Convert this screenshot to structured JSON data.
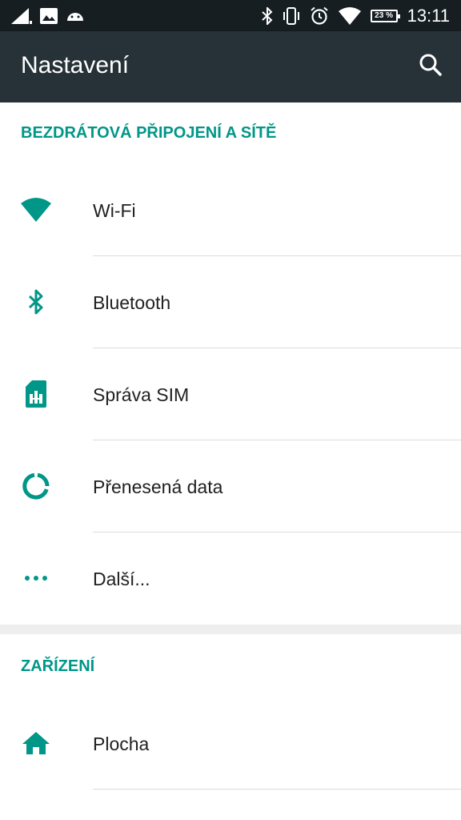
{
  "statusbar": {
    "battery": "23 %",
    "time": "13:11",
    "icons": [
      "signal-icon",
      "image-notification-icon",
      "android-notification-icon",
      "bluetooth-icon",
      "vibrate-icon",
      "alarm-icon",
      "wifi-icon",
      "battery-icon"
    ]
  },
  "appbar": {
    "title": "Nastavení",
    "search_icon": "search-icon"
  },
  "sections": [
    {
      "header": "BEZDRÁTOVÁ PŘIPOJENÍ A SÍTĚ",
      "items": [
        {
          "label": "Wi-Fi",
          "icon": "wifi-icon"
        },
        {
          "label": "Bluetooth",
          "icon": "bluetooth-icon"
        },
        {
          "label": "Správa SIM",
          "icon": "sim-card-icon"
        },
        {
          "label": "Přenesená data",
          "icon": "data-usage-icon"
        },
        {
          "label": "Další...",
          "icon": "more-icon"
        }
      ]
    },
    {
      "header": "ZAŘÍZENÍ",
      "items": [
        {
          "label": "Plocha",
          "icon": "home-icon"
        }
      ]
    }
  ],
  "colors": {
    "accent": "#009688",
    "appbar": "#263238",
    "statusbar": "#161e22"
  }
}
